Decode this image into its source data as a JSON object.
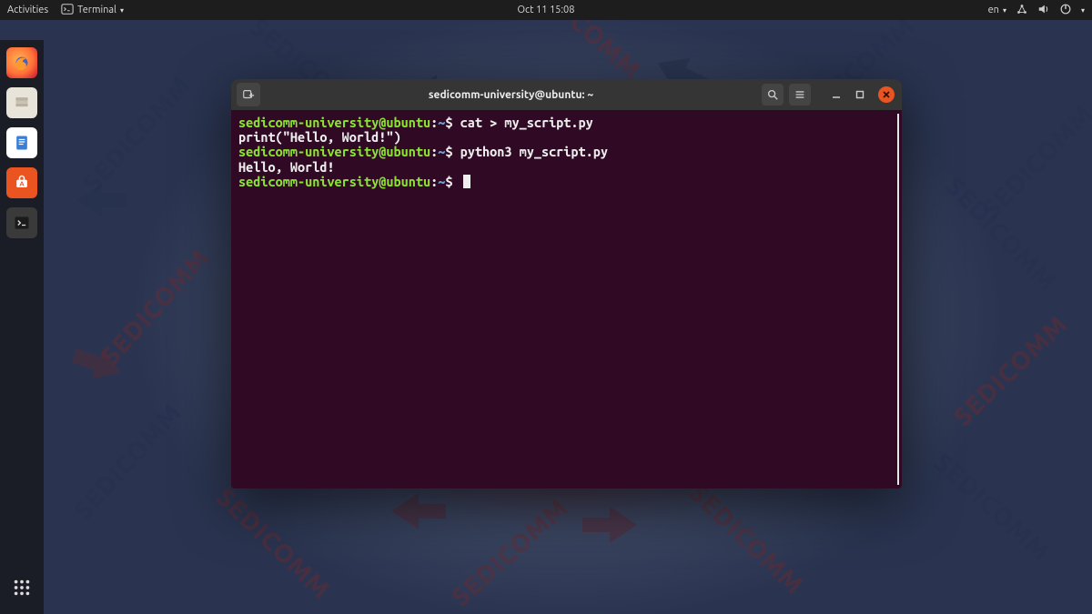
{
  "top_panel": {
    "activities": "Activities",
    "app_name": "Terminal",
    "datetime": "Oct 11  15:08",
    "lang": "en"
  },
  "dock": {
    "items": [
      {
        "name": "firefox-icon"
      },
      {
        "name": "files-icon"
      },
      {
        "name": "document-icon"
      },
      {
        "name": "software-icon"
      },
      {
        "name": "terminal-icon"
      }
    ]
  },
  "terminal": {
    "title": "sedicomm-university@ubuntu: ~",
    "lines": [
      {
        "type": "prompt",
        "user": "sedicomm-university@ubuntu",
        "path": "~",
        "cmd": "cat > my_script.py"
      },
      {
        "type": "output",
        "text": "print(\"Hello, World!\")"
      },
      {
        "type": "prompt",
        "user": "sedicomm-university@ubuntu",
        "path": "~",
        "cmd": "python3 my_script.py"
      },
      {
        "type": "output",
        "text": "Hello, World!"
      },
      {
        "type": "prompt",
        "user": "sedicomm-university@ubuntu",
        "path": "~",
        "cmd": "",
        "cursor": true
      }
    ]
  },
  "wallpaper_text": "SEDICOMM"
}
